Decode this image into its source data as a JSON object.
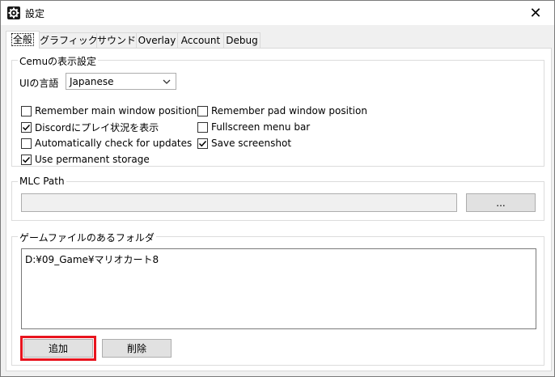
{
  "window": {
    "title": "設定",
    "icon": "gear-icon",
    "close_glyph": "✕"
  },
  "tabs": [
    {
      "label": "全般",
      "active": true
    },
    {
      "label": "グラフィック",
      "active": false
    },
    {
      "label": "サウンド",
      "active": false
    },
    {
      "label": "Overlay",
      "active": false
    },
    {
      "label": "Account",
      "active": false
    },
    {
      "label": "Debug",
      "active": false
    }
  ],
  "display_settings": {
    "title": "Cemuの表示設定",
    "language_label": "UIの言語",
    "language_value": "Japanese",
    "checkboxes": [
      {
        "label": "Remember main window position",
        "checked": false
      },
      {
        "label": "Remember pad window position",
        "checked": false
      },
      {
        "label": "Discordにプレイ状況を表示",
        "checked": true
      },
      {
        "label": "Fullscreen menu bar",
        "checked": false
      },
      {
        "label": "Automatically check for updates",
        "checked": false
      },
      {
        "label": "Save screenshot",
        "checked": true
      },
      {
        "label": "Use permanent storage",
        "checked": true
      }
    ]
  },
  "mlc_path": {
    "title": "MLC Path",
    "value": "",
    "browse_label": "..."
  },
  "game_folders": {
    "title": "ゲームファイルのあるフォルダ",
    "items": [
      "D:¥09_Game¥マリオカート8"
    ],
    "add_label": "追加",
    "remove_label": "削除"
  },
  "colors": {
    "highlight": "#e8141e",
    "window_bg": "#f0f0f0"
  }
}
